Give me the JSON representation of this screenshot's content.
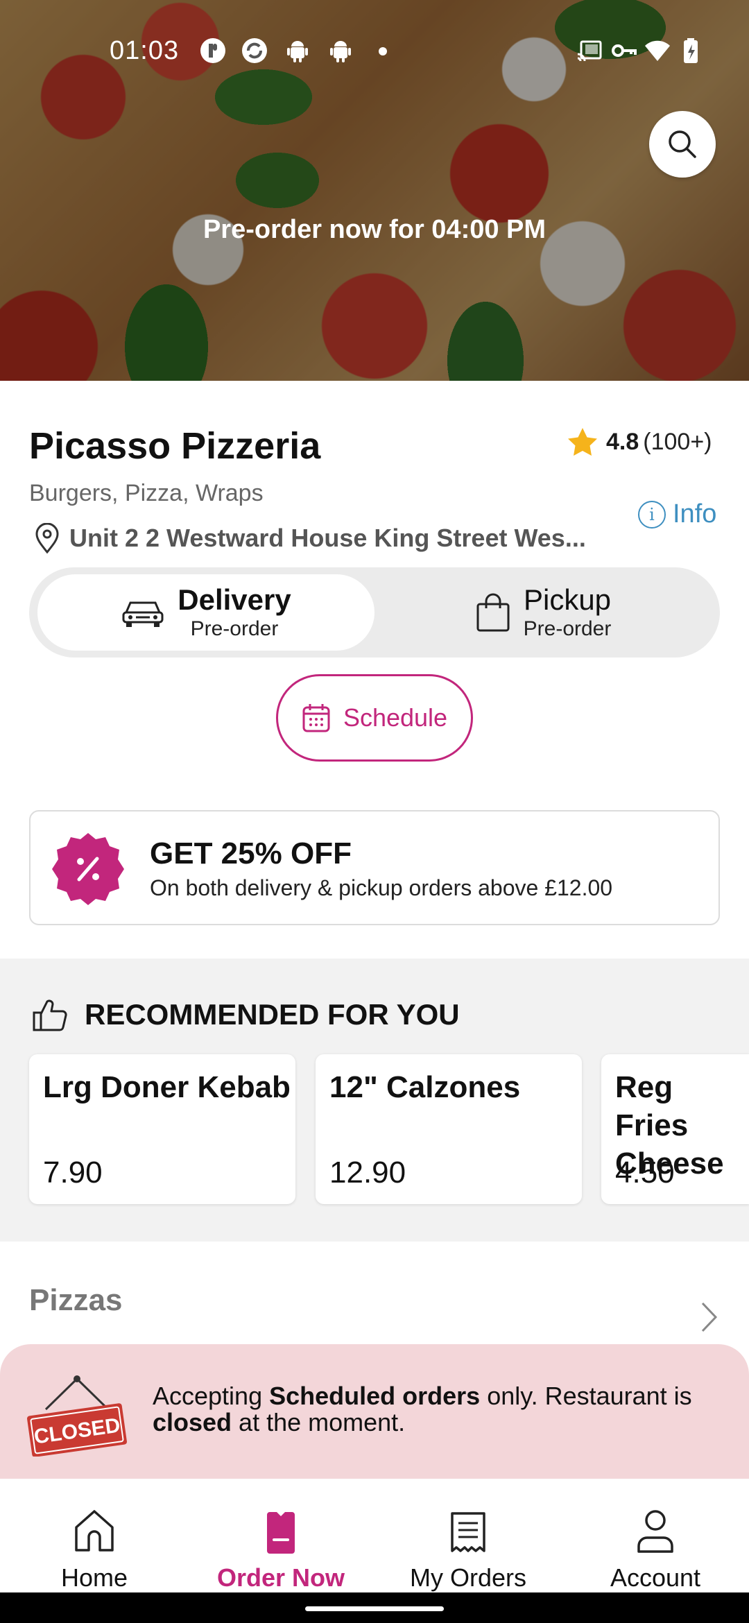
{
  "status_bar": {
    "time": "01:03"
  },
  "hero": {
    "preorder_text": "Pre-order now for 04:00 PM"
  },
  "restaurant": {
    "name": "Picasso Pizzeria",
    "rating": "4.8",
    "rating_count": "(100+)",
    "cuisines": "Burgers, Pizza, Wraps",
    "info_label": "Info",
    "address": "Unit 2 2 Westward House King Street Wes..."
  },
  "order_mode": {
    "delivery": {
      "label": "Delivery",
      "sub": "Pre-order",
      "selected": true
    },
    "pickup": {
      "label": "Pickup",
      "sub": "Pre-order",
      "selected": false
    }
  },
  "schedule": {
    "label": "Schedule"
  },
  "offer": {
    "title": "GET 25% OFF",
    "subtitle": "On both delivery & pickup orders above £12.00"
  },
  "recommended": {
    "title": "RECOMMENDED FOR YOU",
    "items": [
      {
        "name": "Lrg Doner Kebab",
        "price": "7.90"
      },
      {
        "name": "12\" Calzones",
        "price": "12.90"
      },
      {
        "name": "Reg Fries Cheese",
        "price": "4.50"
      }
    ]
  },
  "menu": {
    "first_category": "Pizzas"
  },
  "closed_banner": {
    "sign_text": "CLOSED",
    "part1": "Accepting ",
    "bold1": "Scheduled orders",
    "part2": " only. Restaurant is ",
    "bold2": "closed",
    "part3": " at the moment."
  },
  "bottom_nav": {
    "items": [
      {
        "label": "Home",
        "icon": "home-icon",
        "active": false
      },
      {
        "label": "Order Now",
        "icon": "order-now-icon",
        "active": true
      },
      {
        "label": "My Orders",
        "icon": "receipt-icon",
        "active": false
      },
      {
        "label": "Account",
        "icon": "person-icon",
        "active": false
      }
    ]
  },
  "colors": {
    "accent": "#c2267c",
    "info_blue": "#3e8fc0",
    "star": "#f5b31b",
    "closed_banner_bg": "#f3d6d9",
    "recommended_bg": "#f2f2f2"
  }
}
